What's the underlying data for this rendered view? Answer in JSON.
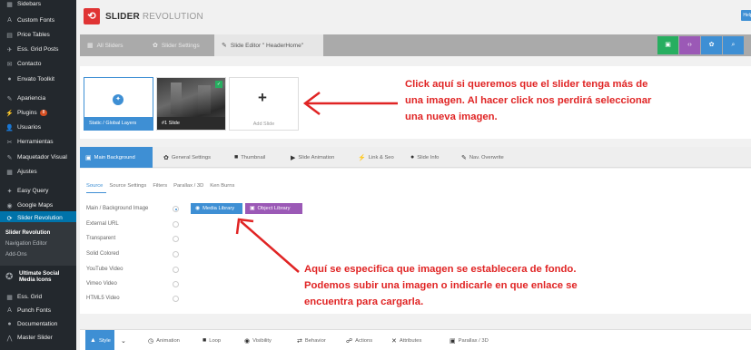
{
  "sidebar": {
    "items": [
      {
        "icon": "grid-icon",
        "glyph": "▦",
        "label": "Sidebars"
      },
      {
        "icon": "font-icon",
        "glyph": "A",
        "label": "Custom Fonts"
      },
      {
        "icon": "table-icon",
        "glyph": "▤",
        "label": "Price Tables"
      },
      {
        "icon": "pin-icon",
        "glyph": "✈",
        "label": "Ess. Grid Posts"
      },
      {
        "icon": "mail-icon",
        "glyph": "✉",
        "label": "Contacto"
      },
      {
        "icon": "toolkit-icon",
        "glyph": "●",
        "label": "Envato Toolkit"
      },
      {
        "icon": "brush-icon",
        "glyph": "✎",
        "label": "Apariencia"
      },
      {
        "icon": "plugin-icon",
        "glyph": "⚡",
        "label": "Plugins",
        "badge": "8"
      },
      {
        "icon": "users-icon",
        "glyph": "👤",
        "label": "Usuarios"
      },
      {
        "icon": "wrench-icon",
        "glyph": "✂",
        "label": "Herramientas"
      },
      {
        "icon": "pencil-icon",
        "glyph": "✎",
        "label": "Maquetador Visual"
      },
      {
        "icon": "settings-icon",
        "glyph": "▦",
        "label": "Ajustes"
      },
      {
        "icon": "query-icon",
        "glyph": "✦",
        "label": "Easy Query"
      },
      {
        "icon": "map-pin-icon",
        "glyph": "◉",
        "label": "Google Maps"
      },
      {
        "icon": "refresh-icon",
        "glyph": "⟳",
        "label": "Slider Revolution"
      }
    ],
    "submenu": [
      {
        "label": "Slider Revolution"
      },
      {
        "label": "Navigation Editor"
      },
      {
        "label": "Add-Ons"
      }
    ],
    "social": {
      "line1": "Ultimate Social",
      "line2": "Media Icons"
    },
    "bottom_items": [
      {
        "icon": "grid-icon",
        "glyph": "▦",
        "label": "Ess. Grid"
      },
      {
        "icon": "font-icon",
        "glyph": "A",
        "label": "Punch Fonts"
      },
      {
        "icon": "docs-icon",
        "glyph": "●",
        "label": "Documentation"
      },
      {
        "icon": "master-icon",
        "glyph": "⋀",
        "label": "Master Slider"
      }
    ]
  },
  "header": {
    "logo_glyph": "⟲",
    "brand_bold": "SLIDER",
    "brand_light": "REVOLUTION",
    "help": "Help"
  },
  "nav": {
    "tabs": [
      {
        "icon": "grid-icon",
        "glyph": "▦",
        "label": "All Sliders"
      },
      {
        "icon": "gear-icon",
        "glyph": "✿",
        "label": "Slider Settings"
      },
      {
        "icon": "pencil-icon",
        "glyph": "✎",
        "label": "Slide Editor \" HeaderHome\""
      }
    ],
    "buttons": [
      {
        "icon": "save-icon",
        "glyph": "▣",
        "color": "#27ae60"
      },
      {
        "icon": "code-icon",
        "glyph": "‹›",
        "color": "#9b59b6"
      },
      {
        "icon": "gear-icon",
        "glyph": "✿",
        "color": "#3e8fd4"
      },
      {
        "icon": "search-icon",
        "glyph": "⌕",
        "color": "#3e8fd4"
      }
    ]
  },
  "slides": {
    "static": {
      "label": "Static / Global Layers"
    },
    "slide1": {
      "label": "#1 Slide"
    },
    "add": {
      "label": "Add Slide",
      "glyph": "+"
    }
  },
  "annotations": {
    "top": [
      "Click aquí si queremos que el slider tenga más de",
      "una imagen. Al hacer click nos perdirá seleccionar",
      "una nueva imagen."
    ],
    "bottom": [
      "Aquí se especifica que imagen se establecera de fondo.",
      "Podemos subir una imagen o indicarle en que enlace se",
      "encuentra para cargarla."
    ],
    "color": "#e02424"
  },
  "tabs": [
    {
      "icon": "image-icon",
      "glyph": "▣",
      "label": "Main Background"
    },
    {
      "icon": "gear-icon",
      "glyph": "✿",
      "label": "General Settings"
    },
    {
      "icon": "camera-icon",
      "glyph": "■",
      "label": "Thumbnail"
    },
    {
      "icon": "film-icon",
      "glyph": "▶",
      "label": "Slide Animation"
    },
    {
      "icon": "link-icon",
      "glyph": "⚡",
      "label": "Link & Seo"
    },
    {
      "icon": "info-icon",
      "glyph": "●",
      "label": "Slide Info"
    },
    {
      "icon": "wand-icon",
      "glyph": "✎",
      "label": "Nav. Overwrite"
    }
  ],
  "subtabs": [
    "Source",
    "Source Settings",
    "Filters",
    "Parallax / 3D",
    "Ken Burns"
  ],
  "options": [
    {
      "label": "Main / Background Image",
      "checked": true
    },
    {
      "label": "External URL",
      "checked": false
    },
    {
      "label": "Transparent",
      "checked": false
    },
    {
      "label": "Solid Colored",
      "checked": false
    },
    {
      "label": "YouTube Video",
      "checked": false
    },
    {
      "label": "Vimeo Video",
      "checked": false
    },
    {
      "label": "HTML5 Video",
      "checked": false
    }
  ],
  "library_buttons": [
    {
      "icon": "image-icon",
      "glyph": "◉",
      "label": "Media Library",
      "color": "#3e8fd4"
    },
    {
      "icon": "folder-icon",
      "glyph": "▣",
      "label": "Object Library",
      "color": "#9b59b6"
    }
  ],
  "bottom_toolbar": [
    {
      "icon": "style-icon",
      "glyph": "▲",
      "label": "Style"
    },
    {
      "icon": "chevron-down-icon",
      "glyph": "⌄",
      "label": ""
    },
    {
      "icon": "animation-icon",
      "glyph": "◷",
      "label": "Animation"
    },
    {
      "icon": "loop-icon",
      "glyph": "■",
      "label": "Loop"
    },
    {
      "icon": "eye-icon",
      "glyph": "◉",
      "label": "Visibility"
    },
    {
      "icon": "behavior-icon",
      "glyph": "⇄",
      "label": "Behavior"
    },
    {
      "icon": "actions-icon",
      "glyph": "☍",
      "label": "Actions"
    },
    {
      "icon": "attributes-icon",
      "glyph": "✕",
      "label": "Attributes"
    },
    {
      "icon": "parallax-icon",
      "glyph": "▣",
      "label": "Parallax / 3D"
    }
  ]
}
